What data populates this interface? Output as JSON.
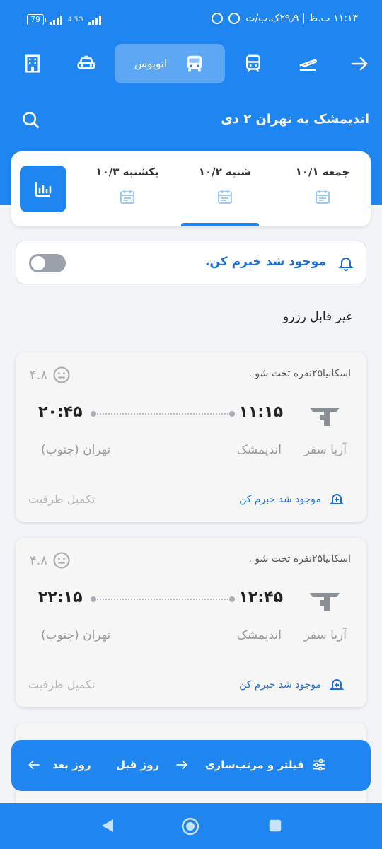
{
  "status_bar": {
    "battery": "79",
    "network": "4.5G",
    "time_info": "۱۱:۱۳ ب.ظ | ۲۹٫۹ک.ب/ث"
  },
  "transport_tabs": {
    "active_label": "اتوبوس",
    "icons": [
      "hotel-icon",
      "taxi-icon",
      "bus-icon",
      "train-icon",
      "airplane-icon",
      "arrow-right-icon"
    ]
  },
  "route": {
    "title": "اندیمشک به تهران ۲ دی"
  },
  "date_tabs": [
    {
      "label": "جمعه ۱۰/۱"
    },
    {
      "label": "شنبه ۱۰/۲"
    },
    {
      "label": "یکشنبه ۱۰/۳"
    }
  ],
  "notify": {
    "label": "موجود شد خبرم کن."
  },
  "section_title": "غیر قابل رزرو",
  "trips": [
    {
      "bus_type": "اسکانیا۲۵نفره تخت شو .",
      "rating": "۴.۸",
      "departure": "۱۱:۱۵",
      "arrival": "۲۰:۴۵",
      "company": "آریا سفر",
      "origin": "اندیمشک",
      "destination": "تهران (جنوب)",
      "notify_text": "موجود شد خبرم کن",
      "capacity": "تکمیل ظرفیت"
    },
    {
      "bus_type": "اسکانیا۲۵نفره تخت شو .",
      "rating": "۴.۸",
      "departure": "۱۲:۴۵",
      "arrival": "۲۲:۱۵",
      "company": "آریا سفر",
      "origin": "اندیمشک",
      "destination": "تهران (جنوب)",
      "notify_text": "موجود شد خبرم کن",
      "capacity": "تکمیل ظرفیت"
    }
  ],
  "action_bar": {
    "filter": "فیلتر و مرتب‌سازی",
    "prev_day": "روز قبل",
    "next_day": "روز بعد"
  },
  "colors": {
    "primary": "#1f85f0",
    "link": "#1f6fd8"
  }
}
